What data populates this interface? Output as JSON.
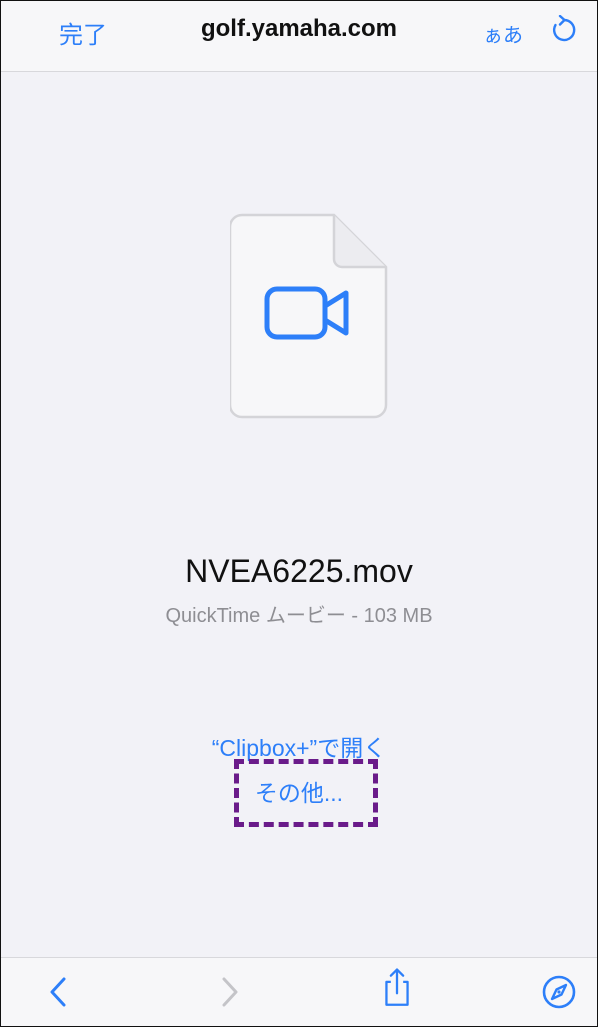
{
  "topbar": {
    "done_label": "完了",
    "host": "golf.yamaha.com",
    "text_size_label": "ぁあ"
  },
  "file": {
    "name": "NVEA6225.mov",
    "info": "QuickTime ムービー - 103 MB"
  },
  "actions": {
    "open_in_label": "“Clipbox+”で開く",
    "more_label": "その他..."
  },
  "colors": {
    "accent": "#2d7ff9",
    "highlight": "#6a1b8a"
  }
}
